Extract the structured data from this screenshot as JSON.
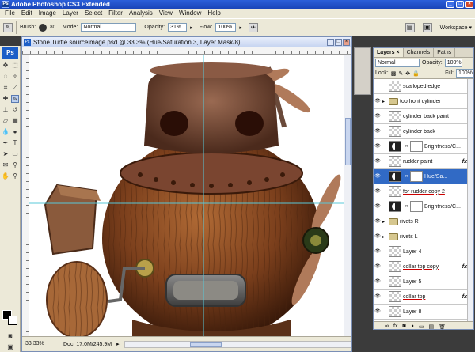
{
  "window": {
    "app_icon": "Ps",
    "title": "Adobe Photoshop CS3 Extended"
  },
  "menu": [
    "File",
    "Edit",
    "Image",
    "Layer",
    "Select",
    "Filter",
    "Analysis",
    "View",
    "Window",
    "Help"
  ],
  "options": {
    "brush_label": "Brush:",
    "brush_size": "80",
    "mode_label": "Mode:",
    "mode_value": "Normal",
    "opacity_label": "Opacity:",
    "opacity_value": "31%",
    "flow_label": "Flow:",
    "flow_value": "100%",
    "workspace_label": "Workspace ▾"
  },
  "toolbox": {
    "logo": "Ps"
  },
  "document": {
    "title": "Stone Turtle sourceimage.psd @ 33.3% (Hue/Saturation 3, Layer Mask/8)",
    "zoom": "33.33%",
    "doc_info": "Doc: 17.0M/245.9M"
  },
  "layers_panel": {
    "tabs": [
      "Layers ×",
      "Channels",
      "Paths"
    ],
    "blend_mode": "Normal",
    "opacity_label": "Opacity:",
    "opacity_value": "100%",
    "lock_label": "Lock:",
    "fill_label": "Fill:",
    "fill_value": "100%",
    "layers": [
      {
        "name": "scalloped edge",
        "visible": false,
        "kind": "pixel",
        "fx": false,
        "selected": false,
        "underline": false
      },
      {
        "name": "top front cylinder",
        "visible": true,
        "kind": "group",
        "fx": false,
        "selected": false,
        "underline": false
      },
      {
        "name": "cylinder back paint",
        "visible": true,
        "kind": "pixel",
        "fx": false,
        "selected": false,
        "underline": true
      },
      {
        "name": "cylinder back",
        "visible": true,
        "kind": "pixel",
        "fx": false,
        "selected": false,
        "underline": true
      },
      {
        "name": "Brightness/C...",
        "visible": true,
        "kind": "adjust",
        "fx": false,
        "selected": false,
        "underline": false
      },
      {
        "name": "rudder paint",
        "visible": true,
        "kind": "pixel",
        "fx": true,
        "selected": false,
        "underline": false
      },
      {
        "name": "Hue/Sa...",
        "visible": true,
        "kind": "adjust",
        "fx": false,
        "selected": true,
        "underline": false
      },
      {
        "name": "for rudder copy 2",
        "visible": true,
        "kind": "pixel",
        "fx": false,
        "selected": false,
        "underline": true
      },
      {
        "name": "Brightness/C...",
        "visible": true,
        "kind": "adjust",
        "fx": false,
        "selected": false,
        "underline": false
      },
      {
        "name": "rivets R",
        "visible": true,
        "kind": "group",
        "fx": false,
        "selected": false,
        "underline": false
      },
      {
        "name": "rivets L",
        "visible": true,
        "kind": "group",
        "fx": false,
        "selected": false,
        "underline": false
      },
      {
        "name": "Layer 4",
        "visible": true,
        "kind": "pixel",
        "fx": false,
        "selected": false,
        "underline": false
      },
      {
        "name": "collar top copy",
        "visible": true,
        "kind": "pixel",
        "fx": true,
        "selected": false,
        "underline": true
      },
      {
        "name": "Layer 5",
        "visible": true,
        "kind": "pixel",
        "fx": false,
        "selected": false,
        "underline": false
      },
      {
        "name": "collar top",
        "visible": true,
        "kind": "pixel",
        "fx": true,
        "selected": false,
        "underline": true
      },
      {
        "name": "Layer 8",
        "visible": true,
        "kind": "pixel",
        "fx": false,
        "selected": false,
        "underline": false
      }
    ],
    "fx_label": "fx",
    "footer_icons": [
      "link-icon",
      "fx-icon",
      "mask-icon",
      "adjustment-icon",
      "folder-icon",
      "new-layer-icon",
      "trash-icon"
    ]
  }
}
